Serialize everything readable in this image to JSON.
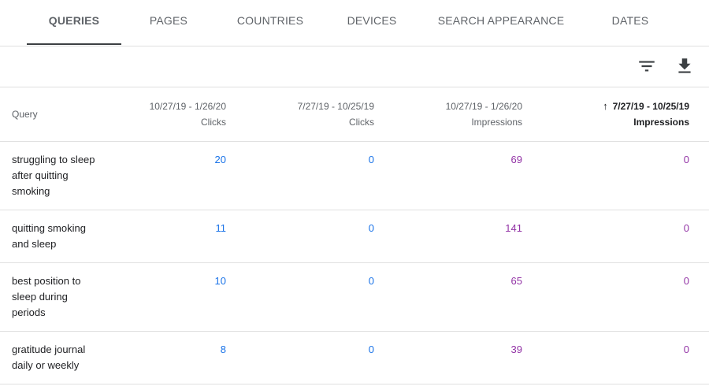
{
  "tabs": [
    {
      "label": "QUERIES",
      "active": true
    },
    {
      "label": "PAGES",
      "active": false
    },
    {
      "label": "COUNTRIES",
      "active": false
    },
    {
      "label": "DEVICES",
      "active": false
    },
    {
      "label": "SEARCH APPEARANCE",
      "active": false
    },
    {
      "label": "DATES",
      "active": false
    }
  ],
  "toolbar": {
    "filter_icon": "filter-icon",
    "download_icon": "download-icon"
  },
  "table": {
    "columns": [
      {
        "date": "",
        "metric": "Query"
      },
      {
        "date": "10/27/19 - 1/26/20",
        "metric": "Clicks"
      },
      {
        "date": "7/27/19 - 10/25/19",
        "metric": "Clicks"
      },
      {
        "date": "10/27/19 - 1/26/20",
        "metric": "Impressions"
      },
      {
        "date": "7/27/19 - 10/25/19",
        "metric": "Impressions",
        "sorted": "ascending"
      }
    ],
    "rows": [
      {
        "query": "struggling to sleep after quitting smoking",
        "clicks_current": "20",
        "clicks_previous": "0",
        "impressions_current": "69",
        "impressions_previous": "0"
      },
      {
        "query": "quitting smoking and sleep",
        "clicks_current": "11",
        "clicks_previous": "0",
        "impressions_current": "141",
        "impressions_previous": "0"
      },
      {
        "query": "best position to sleep during periods",
        "clicks_current": "10",
        "clicks_previous": "0",
        "impressions_current": "65",
        "impressions_previous": "0"
      },
      {
        "query": "gratitude journal daily or weekly",
        "clicks_current": "8",
        "clicks_previous": "0",
        "impressions_current": "39",
        "impressions_previous": "0"
      }
    ]
  },
  "colors": {
    "clicks": "#1a73e8",
    "impressions": "#9334a6",
    "divider": "#e0e0e0"
  }
}
